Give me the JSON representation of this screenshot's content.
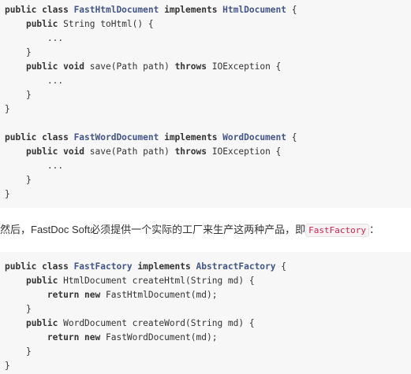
{
  "code_block_1": {
    "lines": [
      [
        {
          "t": "public class ",
          "s": "kw"
        },
        {
          "t": "FastHtmlDocument",
          "s": "ty"
        },
        {
          "t": " implements ",
          "s": "kw"
        },
        {
          "t": "HtmlDocument",
          "s": "ty"
        },
        {
          "t": " {",
          "s": "txt"
        }
      ],
      [
        {
          "t": "    ",
          "s": "txt"
        },
        {
          "t": "public",
          "s": "kw"
        },
        {
          "t": " String toHtml() {",
          "s": "txt"
        }
      ],
      [
        {
          "t": "        ...",
          "s": "txt"
        }
      ],
      [
        {
          "t": "    }",
          "s": "txt"
        }
      ],
      [
        {
          "t": "    ",
          "s": "txt"
        },
        {
          "t": "public void",
          "s": "kw"
        },
        {
          "t": " save(Path path) ",
          "s": "txt"
        },
        {
          "t": "throws",
          "s": "kw"
        },
        {
          "t": " IOException {",
          "s": "txt"
        }
      ],
      [
        {
          "t": "        ...",
          "s": "txt"
        }
      ],
      [
        {
          "t": "    }",
          "s": "txt"
        }
      ],
      [
        {
          "t": "}",
          "s": "txt"
        }
      ],
      [],
      [
        {
          "t": "public class ",
          "s": "kw"
        },
        {
          "t": "FastWordDocument",
          "s": "ty"
        },
        {
          "t": " implements ",
          "s": "kw"
        },
        {
          "t": "WordDocument",
          "s": "ty"
        },
        {
          "t": " {",
          "s": "txt"
        }
      ],
      [
        {
          "t": "    ",
          "s": "txt"
        },
        {
          "t": "public void",
          "s": "kw"
        },
        {
          "t": " save(Path path) ",
          "s": "txt"
        },
        {
          "t": "throws",
          "s": "kw"
        },
        {
          "t": " IOException {",
          "s": "txt"
        }
      ],
      [
        {
          "t": "        ...",
          "s": "txt"
        }
      ],
      [
        {
          "t": "    }",
          "s": "txt"
        }
      ],
      [
        {
          "t": "}",
          "s": "txt"
        }
      ]
    ]
  },
  "paragraph": {
    "text": "然后，FastDoc Soft必须提供一个实际的工厂来生产这两种产品，即",
    "inline_code": "FastFactory",
    "suffix": "："
  },
  "code_block_2": {
    "lines": [
      [
        {
          "t": "public class ",
          "s": "kw"
        },
        {
          "t": "FastFactory",
          "s": "ty"
        },
        {
          "t": " implements ",
          "s": "kw"
        },
        {
          "t": "AbstractFactory",
          "s": "ty"
        },
        {
          "t": " {",
          "s": "txt"
        }
      ],
      [
        {
          "t": "    ",
          "s": "txt"
        },
        {
          "t": "public",
          "s": "kw"
        },
        {
          "t": " HtmlDocument createHtml(String md) {",
          "s": "txt"
        }
      ],
      [
        {
          "t": "        ",
          "s": "txt"
        },
        {
          "t": "return new",
          "s": "kw"
        },
        {
          "t": " FastHtmlDocument(md);",
          "s": "txt"
        }
      ],
      [
        {
          "t": "    }",
          "s": "txt"
        }
      ],
      [
        {
          "t": "    ",
          "s": "txt"
        },
        {
          "t": "public",
          "s": "kw"
        },
        {
          "t": " WordDocument createWord(String md) {",
          "s": "txt"
        }
      ],
      [
        {
          "t": "        ",
          "s": "txt"
        },
        {
          "t": "return new",
          "s": "kw"
        },
        {
          "t": " FastWordDocument(md);",
          "s": "txt"
        }
      ],
      [
        {
          "t": "    }",
          "s": "txt"
        }
      ],
      [
        {
          "t": "}",
          "s": "txt"
        }
      ]
    ]
  }
}
